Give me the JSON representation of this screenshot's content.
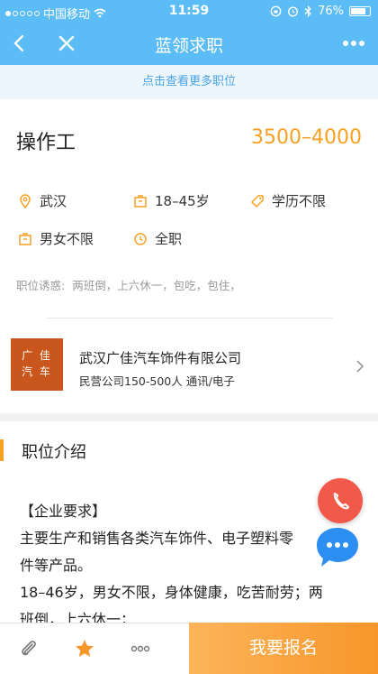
{
  "status_bar": {
    "carrier": "中国移动",
    "time": "11:59",
    "battery": "76%"
  },
  "nav": {
    "title": "蓝领求职",
    "icons": [
      "back-icon",
      "close-icon",
      "more-icon"
    ]
  },
  "banner": {
    "text": "点击查看更多职位"
  },
  "job": {
    "title": "操作工",
    "salary": "3500–4000",
    "attributes": [
      {
        "icon": "location-icon",
        "text": "武汉"
      },
      {
        "icon": "briefcase-icon",
        "text": "18–45岁"
      },
      {
        "icon": "tag-icon",
        "text": "学历不限"
      },
      {
        "icon": "briefcase-icon",
        "text": "男女不限"
      },
      {
        "icon": "clock-icon",
        "text": "全职"
      }
    ],
    "perks_label": "职位诱惑:",
    "perks": "两班倒，上六休一，包吃，包住，"
  },
  "company": {
    "logo_text_line1": "广 佳",
    "logo_text_line2": "汽 车",
    "name": "武汉广佳汽车饰件有限公司",
    "meta": "民营公司150-500人 通讯/电子"
  },
  "section": {
    "title": "职位介绍",
    "lines": [
      "【企业要求】",
      "主要生产和销售各类汽车饰件、电子塑料零",
      "件等产品。",
      "18–46岁，男女不限，身体健康，吃苦耐劳；两",
      "班倒，上六休一；"
    ]
  },
  "bottom_bar": {
    "apply_label": "我要报名",
    "icons": [
      "attachment-icon",
      "star-icon",
      "more-icon"
    ]
  },
  "colors": {
    "nav_blue": "#5bbcf6",
    "accent_orange": "#f5a123",
    "banner_text": "#4aa3e6",
    "phone_red": "#f15a4a",
    "chat_blue": "#2b8ef0",
    "logo_bg": "#c9561c"
  }
}
